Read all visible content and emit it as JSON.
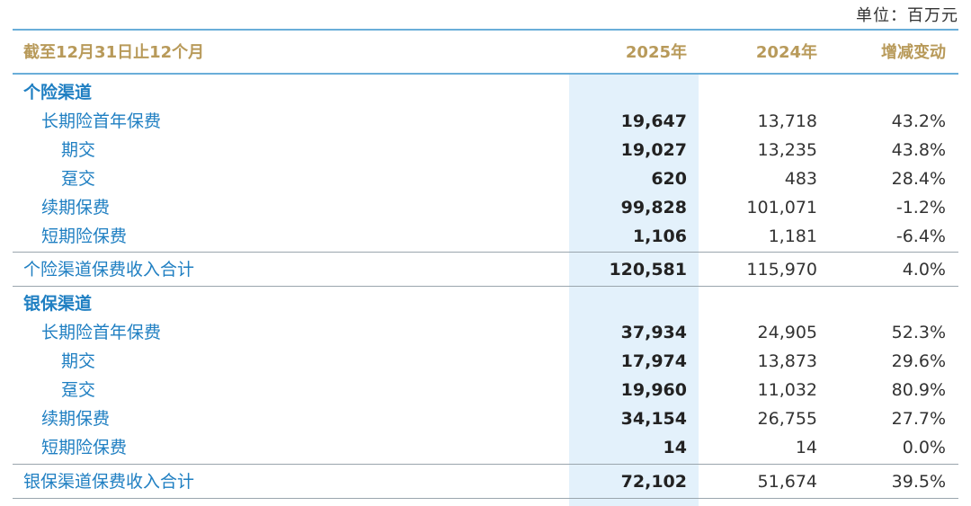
{
  "unit_label": "单位：百万元",
  "header": {
    "period": "截至12月31日止12个月",
    "col_2025": "2025年",
    "col_2024": "2024年",
    "col_change": "增减变动"
  },
  "sections": [
    {
      "title": "个险渠道",
      "rows": [
        {
          "label": "长期险首年保费",
          "v2025": "19,647",
          "v2024": "13,718",
          "change": "43.2%"
        },
        {
          "label": "期交",
          "v2025": "19,027",
          "v2024": "13,235",
          "change": "43.8%"
        },
        {
          "label": "趸交",
          "v2025": "620",
          "v2024": "483",
          "change": "28.4%"
        },
        {
          "label": "续期保费",
          "v2025": "99,828",
          "v2024": "101,071",
          "change": "-1.2%"
        },
        {
          "label": "短期险保费",
          "v2025": "1,106",
          "v2024": "1,181",
          "change": "-6.4%"
        }
      ],
      "total": {
        "label": "个险渠道保费收入合计",
        "v2025": "120,581",
        "v2024": "115,970",
        "change": "4.0%"
      }
    },
    {
      "title": "银保渠道",
      "rows": [
        {
          "label": "长期险首年保费",
          "v2025": "37,934",
          "v2024": "24,905",
          "change": "52.3%"
        },
        {
          "label": "期交",
          "v2025": "17,974",
          "v2024": "13,873",
          "change": "29.6%"
        },
        {
          "label": "趸交",
          "v2025": "19,960",
          "v2024": "11,032",
          "change": "80.9%"
        },
        {
          "label": "续期保费",
          "v2025": "34,154",
          "v2024": "26,755",
          "change": "27.7%"
        },
        {
          "label": "短期险保费",
          "v2025": "14",
          "v2024": "14",
          "change": "0.0%"
        }
      ],
      "total": {
        "label": "银保渠道保费收入合计",
        "v2025": "72,102",
        "v2024": "51,674",
        "change": "39.5%"
      }
    }
  ]
}
